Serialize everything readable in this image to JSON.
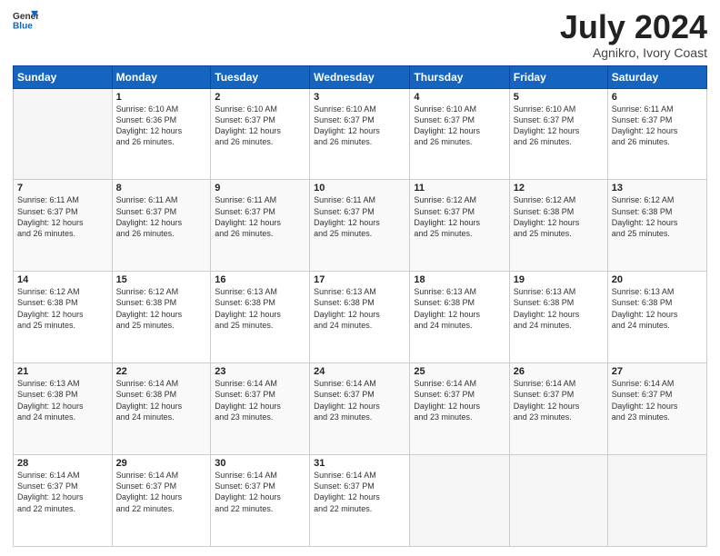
{
  "header": {
    "logo_general": "General",
    "logo_blue": "Blue",
    "title": "July 2024",
    "location": "Agnikro, Ivory Coast"
  },
  "days_of_week": [
    "Sunday",
    "Monday",
    "Tuesday",
    "Wednesday",
    "Thursday",
    "Friday",
    "Saturday"
  ],
  "weeks": [
    [
      {
        "day": "",
        "info": ""
      },
      {
        "day": "1",
        "info": "Sunrise: 6:10 AM\nSunset: 6:36 PM\nDaylight: 12 hours\nand 26 minutes."
      },
      {
        "day": "2",
        "info": "Sunrise: 6:10 AM\nSunset: 6:37 PM\nDaylight: 12 hours\nand 26 minutes."
      },
      {
        "day": "3",
        "info": "Sunrise: 6:10 AM\nSunset: 6:37 PM\nDaylight: 12 hours\nand 26 minutes."
      },
      {
        "day": "4",
        "info": "Sunrise: 6:10 AM\nSunset: 6:37 PM\nDaylight: 12 hours\nand 26 minutes."
      },
      {
        "day": "5",
        "info": "Sunrise: 6:10 AM\nSunset: 6:37 PM\nDaylight: 12 hours\nand 26 minutes."
      },
      {
        "day": "6",
        "info": "Sunrise: 6:11 AM\nSunset: 6:37 PM\nDaylight: 12 hours\nand 26 minutes."
      }
    ],
    [
      {
        "day": "7",
        "info": "Sunrise: 6:11 AM\nSunset: 6:37 PM\nDaylight: 12 hours\nand 26 minutes."
      },
      {
        "day": "8",
        "info": "Sunrise: 6:11 AM\nSunset: 6:37 PM\nDaylight: 12 hours\nand 26 minutes."
      },
      {
        "day": "9",
        "info": "Sunrise: 6:11 AM\nSunset: 6:37 PM\nDaylight: 12 hours\nand 26 minutes."
      },
      {
        "day": "10",
        "info": "Sunrise: 6:11 AM\nSunset: 6:37 PM\nDaylight: 12 hours\nand 25 minutes."
      },
      {
        "day": "11",
        "info": "Sunrise: 6:12 AM\nSunset: 6:37 PM\nDaylight: 12 hours\nand 25 minutes."
      },
      {
        "day": "12",
        "info": "Sunrise: 6:12 AM\nSunset: 6:38 PM\nDaylight: 12 hours\nand 25 minutes."
      },
      {
        "day": "13",
        "info": "Sunrise: 6:12 AM\nSunset: 6:38 PM\nDaylight: 12 hours\nand 25 minutes."
      }
    ],
    [
      {
        "day": "14",
        "info": "Sunrise: 6:12 AM\nSunset: 6:38 PM\nDaylight: 12 hours\nand 25 minutes."
      },
      {
        "day": "15",
        "info": "Sunrise: 6:12 AM\nSunset: 6:38 PM\nDaylight: 12 hours\nand 25 minutes."
      },
      {
        "day": "16",
        "info": "Sunrise: 6:13 AM\nSunset: 6:38 PM\nDaylight: 12 hours\nand 25 minutes."
      },
      {
        "day": "17",
        "info": "Sunrise: 6:13 AM\nSunset: 6:38 PM\nDaylight: 12 hours\nand 24 minutes."
      },
      {
        "day": "18",
        "info": "Sunrise: 6:13 AM\nSunset: 6:38 PM\nDaylight: 12 hours\nand 24 minutes."
      },
      {
        "day": "19",
        "info": "Sunrise: 6:13 AM\nSunset: 6:38 PM\nDaylight: 12 hours\nand 24 minutes."
      },
      {
        "day": "20",
        "info": "Sunrise: 6:13 AM\nSunset: 6:38 PM\nDaylight: 12 hours\nand 24 minutes."
      }
    ],
    [
      {
        "day": "21",
        "info": "Sunrise: 6:13 AM\nSunset: 6:38 PM\nDaylight: 12 hours\nand 24 minutes."
      },
      {
        "day": "22",
        "info": "Sunrise: 6:14 AM\nSunset: 6:38 PM\nDaylight: 12 hours\nand 24 minutes."
      },
      {
        "day": "23",
        "info": "Sunrise: 6:14 AM\nSunset: 6:37 PM\nDaylight: 12 hours\nand 23 minutes."
      },
      {
        "day": "24",
        "info": "Sunrise: 6:14 AM\nSunset: 6:37 PM\nDaylight: 12 hours\nand 23 minutes."
      },
      {
        "day": "25",
        "info": "Sunrise: 6:14 AM\nSunset: 6:37 PM\nDaylight: 12 hours\nand 23 minutes."
      },
      {
        "day": "26",
        "info": "Sunrise: 6:14 AM\nSunset: 6:37 PM\nDaylight: 12 hours\nand 23 minutes."
      },
      {
        "day": "27",
        "info": "Sunrise: 6:14 AM\nSunset: 6:37 PM\nDaylight: 12 hours\nand 23 minutes."
      }
    ],
    [
      {
        "day": "28",
        "info": "Sunrise: 6:14 AM\nSunset: 6:37 PM\nDaylight: 12 hours\nand 22 minutes."
      },
      {
        "day": "29",
        "info": "Sunrise: 6:14 AM\nSunset: 6:37 PM\nDaylight: 12 hours\nand 22 minutes."
      },
      {
        "day": "30",
        "info": "Sunrise: 6:14 AM\nSunset: 6:37 PM\nDaylight: 12 hours\nand 22 minutes."
      },
      {
        "day": "31",
        "info": "Sunrise: 6:14 AM\nSunset: 6:37 PM\nDaylight: 12 hours\nand 22 minutes."
      },
      {
        "day": "",
        "info": ""
      },
      {
        "day": "",
        "info": ""
      },
      {
        "day": "",
        "info": ""
      }
    ]
  ]
}
